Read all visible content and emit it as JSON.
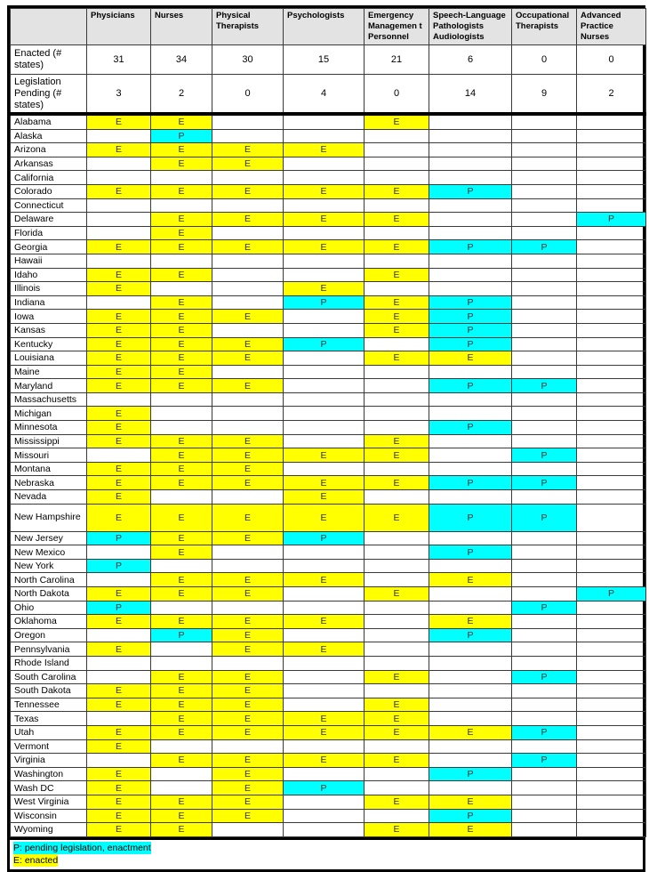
{
  "colors": {
    "enacted": "#ffff00",
    "pending": "#00ffff",
    "header_bg": "#e3e3e3"
  },
  "header": {
    "corner": "",
    "columns": [
      "Physicians",
      "Nurses",
      "Physical Therapists",
      "Psychologists",
      "Emergency Managemen t Personnel",
      "Speech-Language Pathologists Audiologists",
      "Occupational Therapists",
      "Advanced Practice Nurses"
    ]
  },
  "summary": {
    "enacted": {
      "label": "Enacted (# states)",
      "values": [
        "31",
        "34",
        "30",
        "15",
        "21",
        "6",
        "0",
        "0"
      ]
    },
    "pending": {
      "label": "Legislation Pending (# states)",
      "values": [
        "3",
        "2",
        "0",
        "4",
        "0",
        "14",
        "9",
        "2"
      ]
    }
  },
  "states": [
    {
      "name": "Alabama",
      "v": [
        "E",
        "E",
        "",
        "",
        "E",
        "",
        "",
        ""
      ]
    },
    {
      "name": "Alaska",
      "v": [
        "",
        "P",
        "",
        "",
        "",
        "",
        "",
        ""
      ]
    },
    {
      "name": "Arizona",
      "v": [
        "E",
        "E",
        "E",
        "E",
        "",
        "",
        "",
        ""
      ]
    },
    {
      "name": "Arkansas",
      "v": [
        "",
        "E",
        "E",
        "",
        "",
        "",
        "",
        ""
      ]
    },
    {
      "name": "California",
      "v": [
        "",
        "",
        "",
        "",
        "",
        "",
        "",
        ""
      ]
    },
    {
      "name": "Colorado",
      "v": [
        "E",
        "E",
        "E",
        "E",
        "E",
        "P",
        "",
        ""
      ]
    },
    {
      "name": "Connecticut",
      "v": [
        "",
        "",
        "",
        "",
        "",
        "",
        "",
        ""
      ]
    },
    {
      "name": "Delaware",
      "v": [
        "",
        "E",
        "E",
        "E",
        "E",
        "",
        "",
        "P"
      ]
    },
    {
      "name": "Florida",
      "v": [
        "",
        "E",
        "",
        "",
        "",
        "",
        "",
        ""
      ]
    },
    {
      "name": "Georgia",
      "v": [
        "E",
        "E",
        "E",
        "E",
        "E",
        "P",
        "P",
        ""
      ]
    },
    {
      "name": "Hawaii",
      "v": [
        "",
        "",
        "",
        "",
        "",
        "",
        "",
        ""
      ]
    },
    {
      "name": "Idaho",
      "v": [
        "E",
        "E",
        "",
        "",
        "E",
        "",
        "",
        ""
      ]
    },
    {
      "name": "Illinois",
      "v": [
        "E",
        "",
        "",
        "E",
        "",
        "",
        "",
        ""
      ]
    },
    {
      "name": "Indiana",
      "v": [
        "",
        "E",
        "",
        "P",
        "E",
        "P",
        "",
        ""
      ]
    },
    {
      "name": "Iowa",
      "v": [
        "E",
        "E",
        "E",
        "",
        "E",
        "P",
        "",
        ""
      ]
    },
    {
      "name": "Kansas",
      "v": [
        "E",
        "E",
        "",
        "",
        "E",
        "P",
        "",
        ""
      ]
    },
    {
      "name": "Kentucky",
      "v": [
        "E",
        "E",
        "E",
        "P",
        "",
        "P",
        "",
        ""
      ]
    },
    {
      "name": "Louisiana",
      "v": [
        "E",
        "E",
        "E",
        "",
        "E",
        "E",
        "",
        ""
      ]
    },
    {
      "name": "Maine",
      "v": [
        "E",
        "E",
        "",
        "",
        "",
        "",
        "",
        ""
      ]
    },
    {
      "name": "Maryland",
      "v": [
        "E",
        "E",
        "E",
        "",
        "",
        "P",
        "P",
        ""
      ]
    },
    {
      "name": "Massachusetts",
      "v": [
        "",
        "",
        "",
        "",
        "",
        "",
        "",
        ""
      ]
    },
    {
      "name": "Michigan",
      "v": [
        "E",
        "",
        "",
        "",
        "",
        "",
        "",
        ""
      ]
    },
    {
      "name": "Minnesota",
      "v": [
        "E",
        "",
        "",
        "",
        "",
        "P",
        "",
        ""
      ]
    },
    {
      "name": "Mississippi",
      "v": [
        "E",
        "E",
        "E",
        "",
        "E",
        "",
        "",
        ""
      ]
    },
    {
      "name": "Missouri",
      "v": [
        "",
        "E",
        "E",
        "E",
        "E",
        "",
        "P",
        ""
      ]
    },
    {
      "name": "Montana",
      "v": [
        "E",
        "E",
        "E",
        "",
        "",
        "",
        "",
        ""
      ]
    },
    {
      "name": "Nebraska",
      "v": [
        "E",
        "E",
        "E",
        "E",
        "E",
        "P",
        "P",
        ""
      ]
    },
    {
      "name": "Nevada",
      "v": [
        "E",
        "",
        "",
        "E",
        "",
        "",
        "",
        ""
      ]
    },
    {
      "name": "New Hampshire",
      "v": [
        "E",
        "E",
        "E",
        "E",
        "E",
        "P",
        "P",
        ""
      ],
      "tall": true
    },
    {
      "name": "New Jersey",
      "v": [
        "P",
        "E",
        "E",
        "P",
        "",
        "",
        "",
        ""
      ]
    },
    {
      "name": "New Mexico",
      "v": [
        "",
        "E",
        "",
        "",
        "",
        "P",
        "",
        ""
      ]
    },
    {
      "name": "New York",
      "v": [
        "P",
        "",
        "",
        "",
        "",
        "",
        "",
        ""
      ]
    },
    {
      "name": "North Carolina",
      "v": [
        "",
        "E",
        "E",
        "E",
        "",
        "E",
        "",
        ""
      ]
    },
    {
      "name": "North Dakota",
      "v": [
        "E",
        "E",
        "E",
        "",
        "E",
        "",
        "",
        "P"
      ]
    },
    {
      "name": "Ohio",
      "v": [
        "P",
        "",
        "",
        "",
        "",
        "",
        "P",
        ""
      ]
    },
    {
      "name": "Oklahoma",
      "v": [
        "E",
        "E",
        "E",
        "E",
        "",
        "E",
        "",
        ""
      ]
    },
    {
      "name": "Oregon",
      "v": [
        "",
        "P",
        "E",
        "",
        "",
        "P",
        "",
        ""
      ]
    },
    {
      "name": "Pennsylvania",
      "v": [
        "E",
        "",
        "E",
        "E",
        "",
        "",
        "",
        ""
      ]
    },
    {
      "name": "Rhode Island",
      "v": [
        "",
        "",
        "",
        "",
        "",
        "",
        "",
        ""
      ]
    },
    {
      "name": "South Carolina",
      "v": [
        "",
        "E",
        "E",
        "",
        "E",
        "",
        "P",
        ""
      ]
    },
    {
      "name": "South Dakota",
      "v": [
        "E",
        "E",
        "E",
        "",
        "",
        "",
        "",
        ""
      ]
    },
    {
      "name": "Tennessee",
      "v": [
        "E",
        "E",
        "E",
        "",
        "E",
        "",
        "",
        ""
      ]
    },
    {
      "name": "Texas",
      "v": [
        "",
        "E",
        "E",
        "E",
        "E",
        "",
        "",
        ""
      ]
    },
    {
      "name": "Utah",
      "v": [
        "E",
        "E",
        "E",
        "E",
        "E",
        "E",
        "P",
        ""
      ]
    },
    {
      "name": "Vermont",
      "v": [
        "E",
        "",
        "",
        "",
        "",
        "",
        "",
        ""
      ]
    },
    {
      "name": "Virginia",
      "v": [
        "",
        "E",
        "E",
        "E",
        "E",
        "",
        "P",
        ""
      ]
    },
    {
      "name": "Washington",
      "v": [
        "E",
        "",
        "E",
        "",
        "",
        "P",
        "",
        ""
      ]
    },
    {
      "name": "Wash DC",
      "v": [
        "E",
        "",
        "E",
        "P",
        "",
        "",
        "",
        ""
      ]
    },
    {
      "name": "West Virginia",
      "v": [
        "E",
        "E",
        "E",
        "",
        "E",
        "E",
        "",
        ""
      ]
    },
    {
      "name": "Wisconsin",
      "v": [
        "E",
        "E",
        "E",
        "",
        "",
        "P",
        "",
        ""
      ]
    },
    {
      "name": "Wyoming",
      "v": [
        "E",
        "E",
        "",
        "",
        "E",
        "E",
        "",
        ""
      ]
    }
  ],
  "legend": {
    "pending": "P: pending legislation, enactment",
    "enacted": "E: enacted"
  }
}
